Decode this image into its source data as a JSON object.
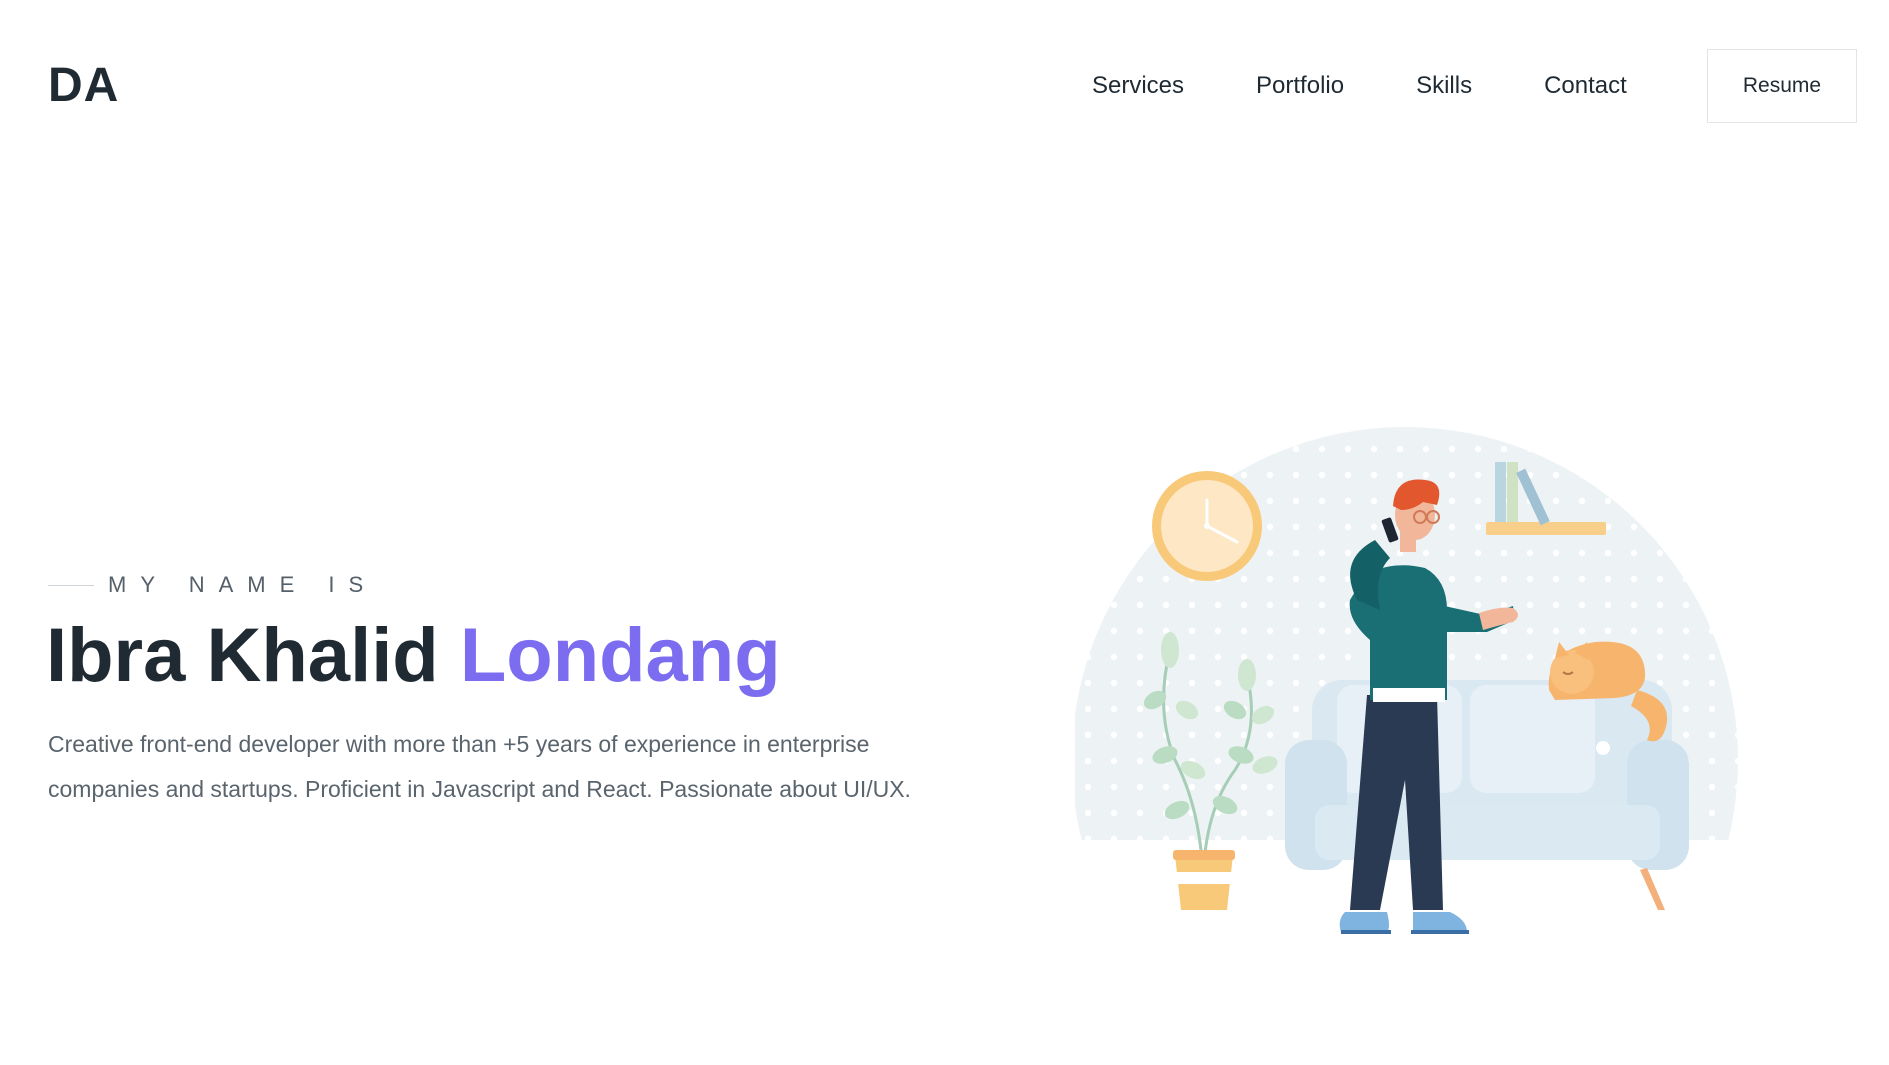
{
  "header": {
    "logo": "DA",
    "nav": [
      {
        "label": "Services"
      },
      {
        "label": "Portfolio"
      },
      {
        "label": "Skills"
      },
      {
        "label": "Contact"
      }
    ],
    "resume_label": "Resume"
  },
  "hero": {
    "eyebrow": "MY NAME IS",
    "name_first": "Ibra Khalid ",
    "name_accent": "Londang",
    "description": "Creative front-end developer with more than +5 years of experience in enterprise companies and startups. Proficient in Javascript and React. Passionate about UI/UX."
  },
  "colors": {
    "accent": "#7c6df0",
    "text": "#1f2a33",
    "muted": "#5a646d"
  },
  "illustration": {
    "icon": "person-on-phone-with-cat-illustration"
  }
}
